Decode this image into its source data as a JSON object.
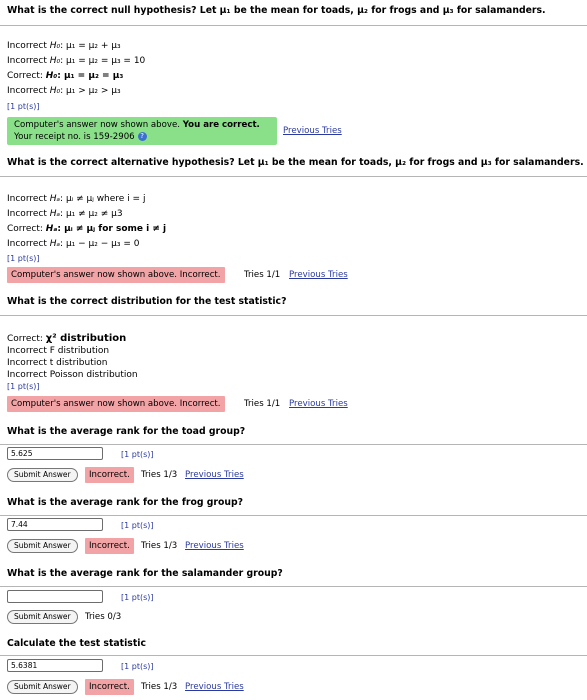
{
  "q1": {
    "question": "What is the correct null hypothesis? Let μ₁ be the mean for toads, μ₂ for frogs and μ₃ for salamanders.",
    "options": [
      {
        "prefix": "Incorrect",
        "sym": "H₀",
        "expr": ": μ₁ = μ₂ + μ₃",
        "bold": false
      },
      {
        "prefix": "Incorrect",
        "sym": "H₀",
        "expr": ": μ₁ = μ₂ = μ₃ = 10",
        "bold": false
      },
      {
        "prefix": "Correct:",
        "sym": "H₀",
        "expr": ": μ₁ = μ₂ = μ₃",
        "bold": true
      },
      {
        "prefix": "Incorrect",
        "sym": "H₀",
        "expr": ": μ₁ > μ₂ > μ₃",
        "bold": false
      }
    ],
    "points": "[1 pt(s)]",
    "feedback_line1": "Computer's answer now shown above.",
    "feedback_bold": "You are correct.",
    "feedback_line2": "Your receipt no. is 159-2906",
    "help_icon": "?",
    "link": "Previous Tries"
  },
  "q2": {
    "question": "What is the correct alternative hypothesis? Let μ₁ be the mean for toads, μ₂ for frogs and μ₃ for salamanders.",
    "options": [
      {
        "prefix": "Incorrect",
        "sym": "Hₐ",
        "expr": ": μᵢ ≠ μⱼ where i = j",
        "bold": false
      },
      {
        "prefix": "Incorrect",
        "sym": "Hₐ",
        "expr": ": μ₁ ≠ μ₂ ≠ μ3",
        "bold": false
      },
      {
        "prefix": "Correct:",
        "sym": "Hₐ",
        "expr": ": μᵢ ≠ μⱼ for some i ≠ j",
        "bold": true
      },
      {
        "prefix": "Incorrect",
        "sym": "Hₐ",
        "expr": ": μ₁ − μ₂ − μ₃ = 0",
        "bold": false
      }
    ],
    "points": "[1 pt(s)]",
    "feedback": "Computer's answer now shown above. Incorrect.",
    "tries": "Tries 1/1",
    "link": "Previous Tries"
  },
  "q3": {
    "question": "What is the correct distribution for the test statistic?",
    "options": [
      {
        "prefix": "Correct:",
        "text": "χ² distribution",
        "bold": true
      },
      {
        "prefix": "Incorrect",
        "text": "F distribution",
        "bold": false
      },
      {
        "prefix": "Incorrect",
        "text": "t distribution",
        "bold": false
      },
      {
        "prefix": "Incorrect",
        "text": "Poisson distribution",
        "bold": false
      }
    ],
    "points": "[1 pt(s)]",
    "feedback": "Computer's answer now shown above. Incorrect.",
    "tries": "Tries 1/1",
    "link": "Previous Tries"
  },
  "q4": {
    "question": "What is the average rank for the toad group?",
    "value": "5.625",
    "points": "[1 pt(s)]",
    "button": "Submit Answer",
    "feedback": "Incorrect.",
    "tries": "Tries 1/3",
    "link": "Previous Tries"
  },
  "q5": {
    "question": "What is the average rank for the frog group?",
    "value": "7.44",
    "points": "[1 pt(s)]",
    "button": "Submit Answer",
    "feedback": "Incorrect.",
    "tries": "Tries 1/3",
    "link": "Previous Tries"
  },
  "q6": {
    "question": "What is the average rank for the salamander group?",
    "value": "",
    "points": "[1 pt(s)]",
    "button": "Submit Answer",
    "tries": "Tries 0/3"
  },
  "q7": {
    "question": "Calculate the test statistic",
    "value": "5.6381",
    "points": "[1 pt(s)]",
    "button": "Submit Answer",
    "feedback": "Incorrect.",
    "tries": "Tries 1/3",
    "link": "Previous Tries"
  }
}
